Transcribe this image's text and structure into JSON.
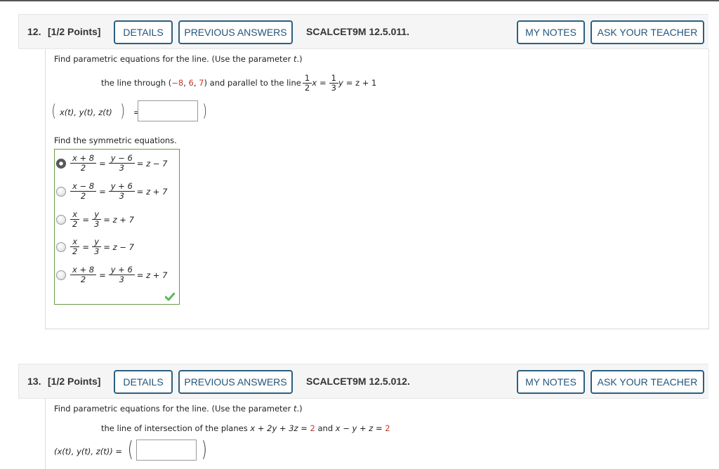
{
  "questions": [
    {
      "number": "12.",
      "points": "[1/2 Points]",
      "buttons": {
        "details": "DETAILS",
        "previous_answers": "PREVIOUS ANSWERS",
        "my_notes": "MY NOTES",
        "ask_teacher": "ASK YOUR TEACHER"
      },
      "code": "SCALCET9M 12.5.011.",
      "prompt": "Find parametric equations for the line. (Use the parameter t.)",
      "prompt_pre": "Find parametric equations for the line. (Use the parameter ",
      "prompt_param": "t",
      "prompt_post": ".)",
      "statement": {
        "pre": "the line through (",
        "point": [
          "−8",
          "6",
          "7"
        ],
        "mid": ") and parallel to the line",
        "line_eq": {
          "frac1": [
            "1",
            "2"
          ],
          "var1": "x",
          "eq": "=",
          "frac2": [
            "1",
            "3"
          ],
          "var2": "y",
          "rest": "= z + 1"
        }
      },
      "answer_label": "x(t), y(t), z(t)",
      "answer_value": "",
      "sub_prompt": "Find the symmetric equations.",
      "choices": [
        {
          "selected": true,
          "t1": [
            "x + 8",
            "2"
          ],
          "t2": [
            "y − 6",
            "3"
          ],
          "rest": "= z − 7"
        },
        {
          "selected": false,
          "t1": [
            "x − 8",
            "2"
          ],
          "t2": [
            "y + 6",
            "3"
          ],
          "rest": "= z + 7"
        },
        {
          "selected": false,
          "t1": [
            "x",
            "2"
          ],
          "t2": [
            "y",
            "3"
          ],
          "rest": "= z + 7"
        },
        {
          "selected": false,
          "t1": [
            "x",
            "2"
          ],
          "t2": [
            "y",
            "3"
          ],
          "rest": "= z − 7"
        },
        {
          "selected": false,
          "t1": [
            "x + 8",
            "2"
          ],
          "t2": [
            "y + 6",
            "3"
          ],
          "rest": "= z + 7"
        }
      ],
      "status": "correct"
    },
    {
      "number": "13.",
      "points": "[1/2 Points]",
      "buttons": {
        "details": "DETAILS",
        "previous_answers": "PREVIOUS ANSWERS",
        "my_notes": "MY NOTES",
        "ask_teacher": "ASK YOUR TEACHER"
      },
      "code": "SCALCET9M 12.5.012.",
      "prompt_pre": "Find parametric equations for the line. (Use the parameter ",
      "prompt_param": "t",
      "prompt_post": ".)",
      "statement": {
        "pre": "the line of intersection of the planes ",
        "plane1": "x + 2y + 3z = ",
        "plane1_val": "2",
        "and": " and ",
        "plane2": "x − y + z = ",
        "plane2_val": "2"
      },
      "answer_label": "(x(t), y(t), z(t)) =",
      "answer_value": ""
    }
  ],
  "colors": {
    "button_border": "#2c5f80",
    "button_text": "#22557a",
    "red_value": "#c0392b",
    "correct_border": "#6a9a48",
    "check": "#5cb85c"
  }
}
